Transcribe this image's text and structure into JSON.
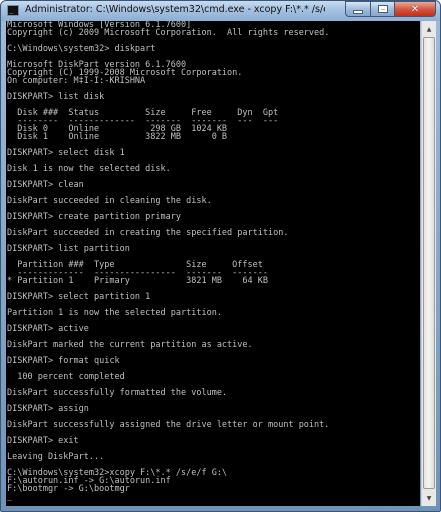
{
  "window": {
    "title": "Administrator: C:\\Windows\\system32\\cmd.exe - xcopy  F:\\*.* /s/e/f G:\\",
    "icon": "cmd-console-icon",
    "minimize_icon": "minimize-icon",
    "maximize_icon": "maximize-icon",
    "close_icon": "close-icon",
    "close_glyph": "✕"
  },
  "console": {
    "background": "#000000",
    "foreground": "#c0c0c0",
    "lines": [
      "Microsoft Windows [Version 6.1.7600]",
      "Copyright (c) 2009 Microsoft Corporation.  All rights reserved.",
      "",
      "C:\\Windows\\system32> diskpart",
      "",
      "Microsoft DiskPart version 6.1.7600",
      "Copyright (C) 1999-2008 Microsoft Corporation.",
      "On computer: M‡I-I:-KRISHNA",
      "",
      "DISKPART> list disk",
      "",
      "  Disk ###  Status         Size     Free     Dyn  Gpt",
      "  --------  -------------  -------  -------  ---  ---",
      "  Disk 0    Online          298 GB  1024 KB",
      "  Disk 1    Online         3822 MB      0 B",
      "",
      "DISKPART> select disk 1",
      "",
      "Disk 1 is now the selected disk.",
      "",
      "DISKPART> clean",
      "",
      "DiskPart succeeded in cleaning the disk.",
      "",
      "DISKPART> create partition primary",
      "",
      "DiskPart succeeded in creating the specified partition.",
      "",
      "DISKPART> list partition",
      "",
      "  Partition ###  Type              Size     Offset",
      "  -------------  ----------------  -------  -------",
      "* Partition 1    Primary           3821 MB    64 KB",
      "",
      "DISKPART> select partition 1",
      "",
      "Partition 1 is now the selected partition.",
      "",
      "DISKPART> active",
      "",
      "DiskPart marked the current partition as active.",
      "",
      "DISKPART> format quick",
      "",
      "  100 percent completed",
      "",
      "DiskPart successfully formatted the volume.",
      "",
      "DISKPART> assign",
      "",
      "DiskPart successfully assigned the drive letter or mount point.",
      "",
      "DISKPART> exit",
      "",
      "Leaving DiskPart...",
      "",
      "C:\\Windows\\system32>xcopy F:\\*.* /s/e/f G:\\",
      "F:\\autorun.inf -> G:\\autorun.inf",
      "F:\\bootmgr -> G:\\bootmgr",
      "_"
    ]
  },
  "scrollbar": {
    "up_arrow": "▲",
    "down_arrow": "▼",
    "up_icon": "scroll-up-arrow-icon",
    "down_icon": "scroll-down-arrow-icon"
  }
}
